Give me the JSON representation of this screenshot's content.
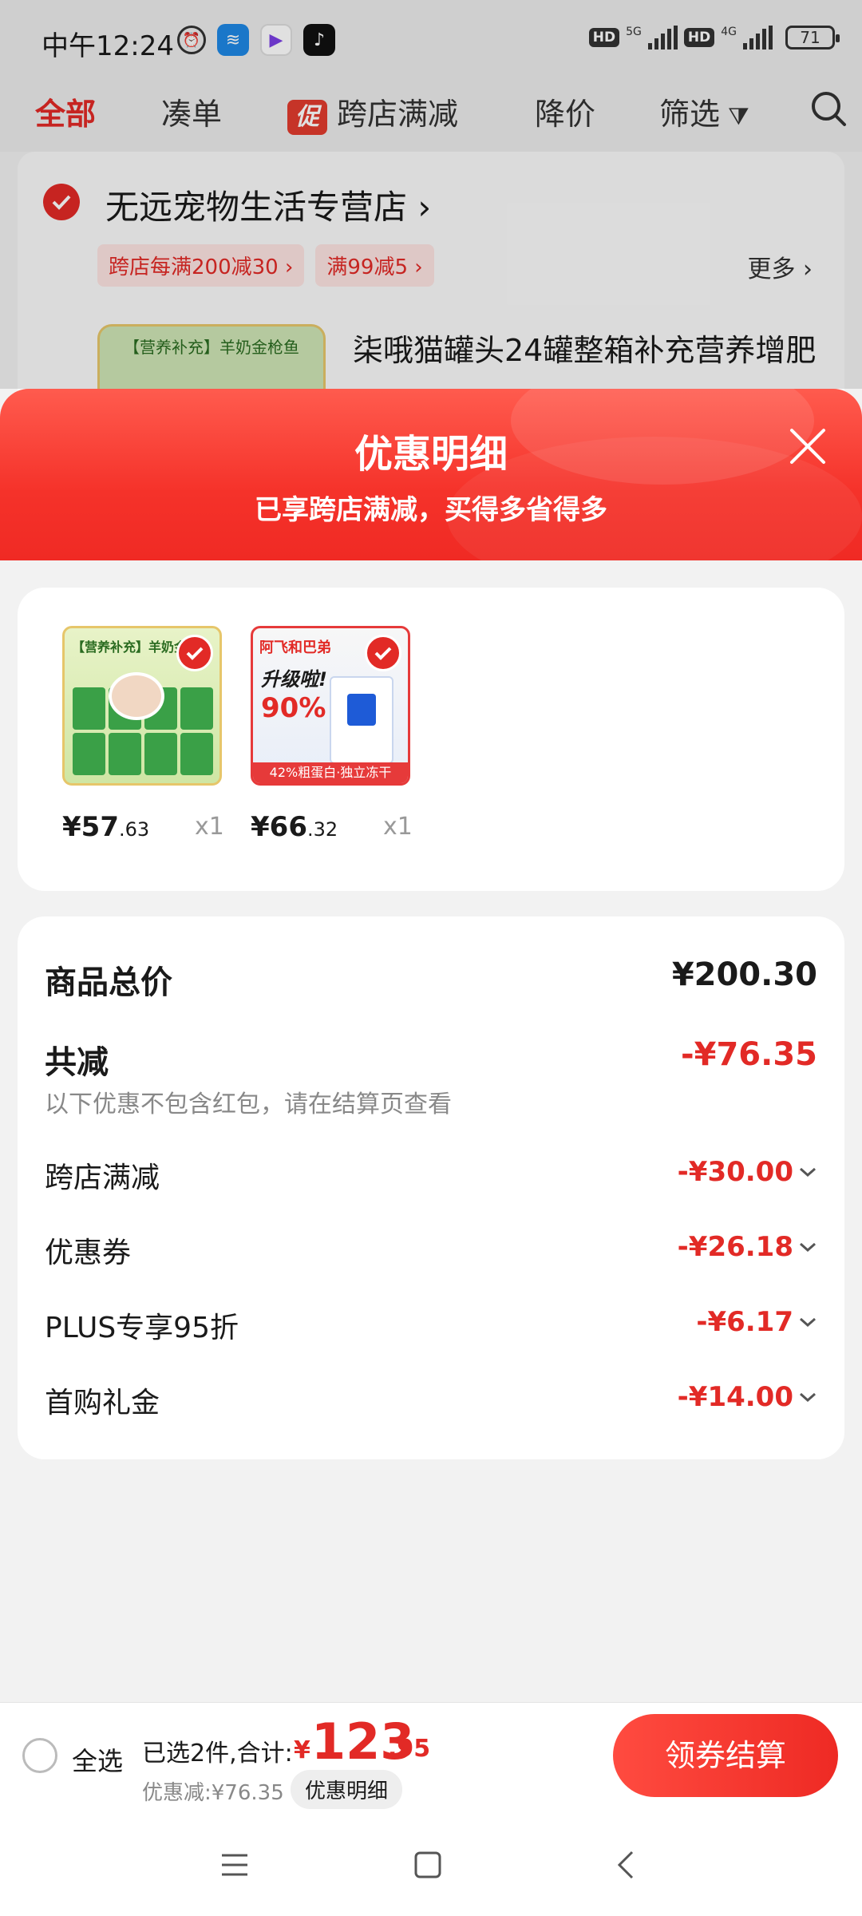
{
  "status_bar": {
    "time": "中午12:24",
    "more": "···",
    "net1": "5G",
    "net2": "4G",
    "hd": "HD",
    "battery": "71"
  },
  "tabs": {
    "all": "全部",
    "combine": "凑单",
    "promo_badge": "促",
    "cross_store": "跨店满减",
    "price_drop": "降价",
    "filter": "筛选"
  },
  "store": {
    "name": "无远宠物生活专营店",
    "tags": [
      "跨店每满200减30",
      "满99减5"
    ],
    "more": "更多",
    "product_title": "柒哦猫罐头24罐整箱补充营养增肥",
    "thumb_label": "【营养补充】羊奶金枪鱼"
  },
  "sheet": {
    "title": "优惠明细",
    "subtitle": "已享跨店满减，买得多省得多"
  },
  "items": [
    {
      "pic_label": "【营养补充】羊奶金枪鱼",
      "price_int": "¥57",
      "price_dec": ".63",
      "qty": "x1"
    },
    {
      "pic_top": "阿飞和巴弟",
      "pic_mid": "升级啦!",
      "pic_pct": "90%",
      "pic_bar": "42%粗蛋白·独立冻干",
      "price_int": "¥66",
      "price_dec": ".32",
      "qty": "x1"
    }
  ],
  "breakdown": {
    "total_label": "商品总价",
    "total_value": "¥200.30",
    "reduce_label": "共减",
    "reduce_value": "-¥76.35",
    "note": "以下优惠不包含红包，请在结算页查看",
    "rows": [
      {
        "label": "跨店满减",
        "value": "-¥30.00"
      },
      {
        "label": "优惠券",
        "value": "-¥26.18"
      },
      {
        "label": "PLUS专享95折",
        "value": "-¥6.17"
      },
      {
        "label": "首购礼金",
        "value": "-¥14.00"
      }
    ]
  },
  "bottom": {
    "select_all": "全选",
    "selected_text": "已选2件,合计:",
    "yen": "¥",
    "total_int": "123",
    "total_dec": ".95",
    "discount_text": "优惠减:¥76.35",
    "detail_btn": "优惠明细",
    "checkout": "领券结算"
  },
  "colors": {
    "accent": "#e22a26",
    "header_gradient_top": "#ff5b4e",
    "header_gradient_bottom": "#f02a24"
  }
}
